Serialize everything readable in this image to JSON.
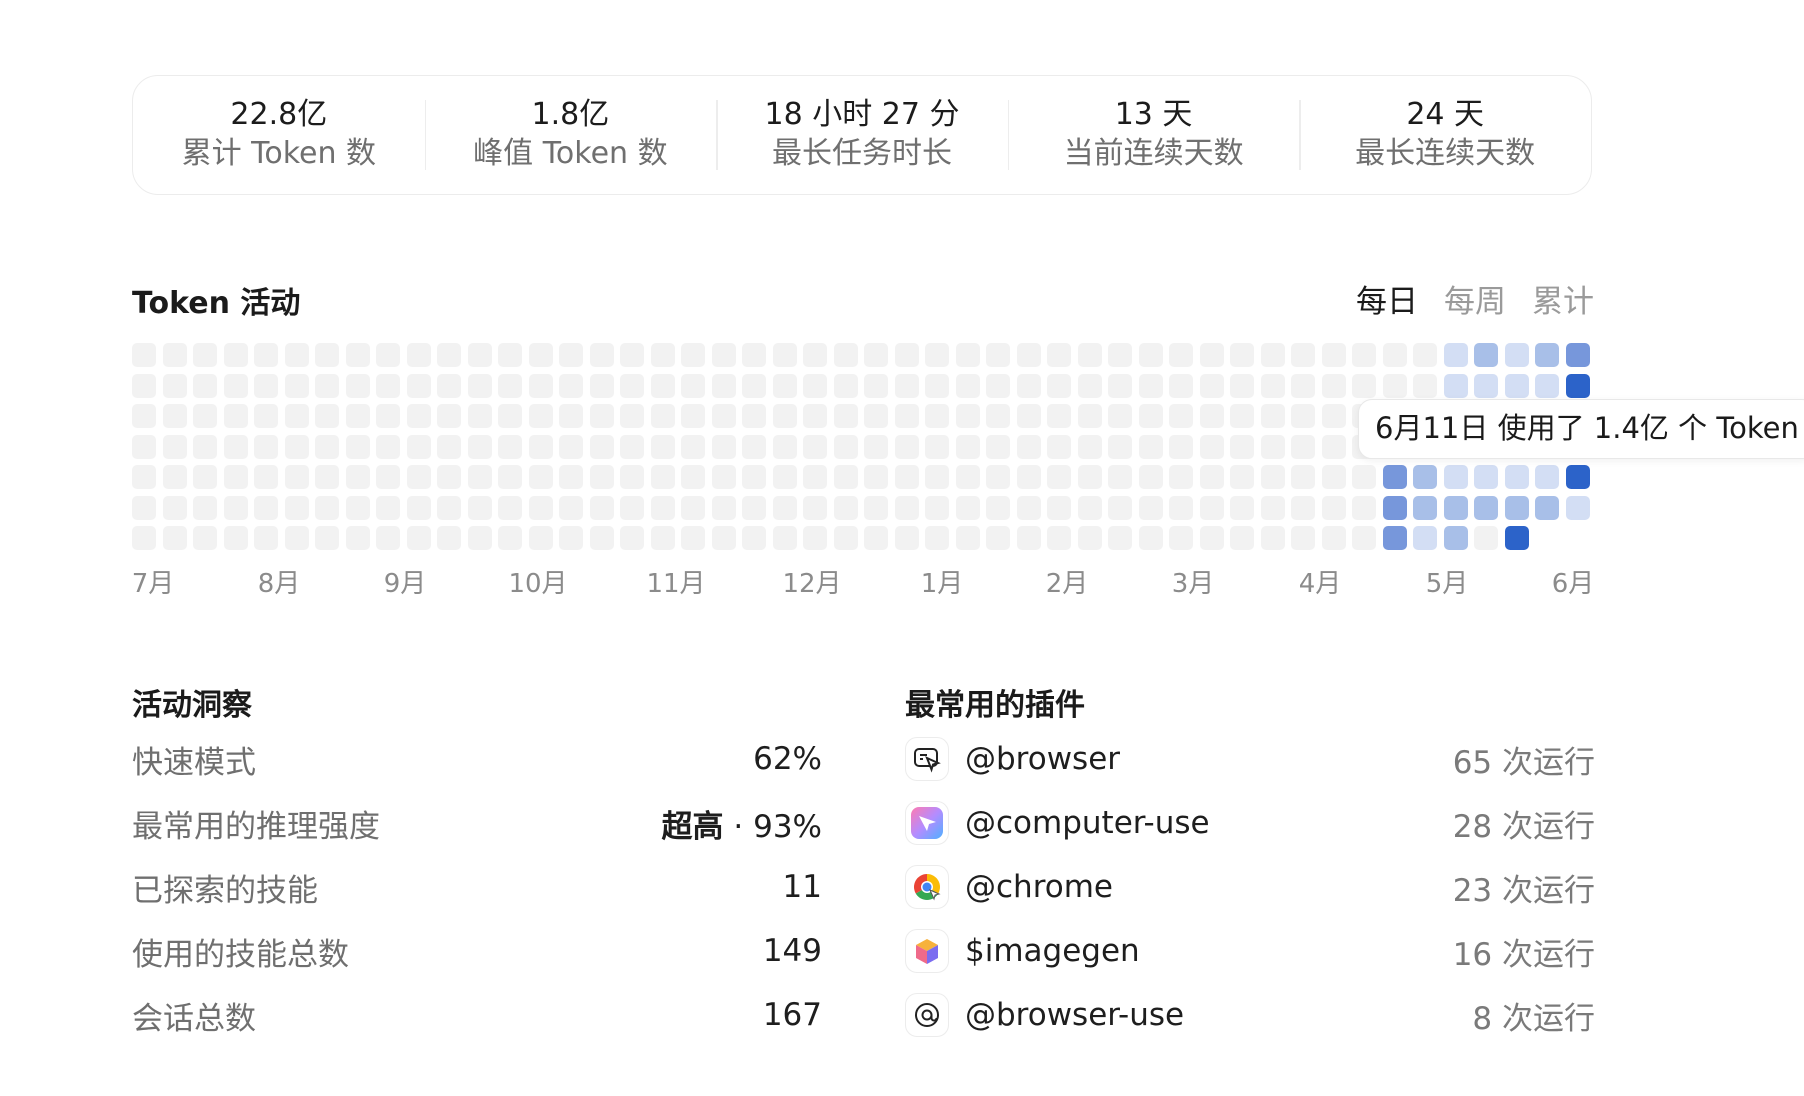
{
  "stats": [
    {
      "value": "22.8亿",
      "label": "累计 Token 数"
    },
    {
      "value": "1.8亿",
      "label": "峰值 Token 数"
    },
    {
      "value": "18 小时 27 分",
      "label": "最长任务时长"
    },
    {
      "value": "13 天",
      "label": "当前连续天数"
    },
    {
      "value": "24 天",
      "label": "最长连续天数"
    }
  ],
  "activity": {
    "title": "Token 活动",
    "tabs": [
      {
        "label": "每日",
        "active": true
      },
      {
        "label": "每周",
        "active": false
      },
      {
        "label": "累计",
        "active": false
      }
    ],
    "months": [
      "7月",
      "8月",
      "9月",
      "10月",
      "11月",
      "12月",
      "1月",
      "2月",
      "3月",
      "4月",
      "5月",
      "6月"
    ],
    "tooltip": "6月11日 使用了 1.4亿 个 Token",
    "level_colors": [
      "#f2f2f2",
      "#d3def4",
      "#a8bfe8",
      "#7797db",
      "#2c63c9"
    ],
    "week_count": 48,
    "active_weeks": [
      [
        0,
        0,
        0,
        0,
        0,
        0,
        0
      ],
      [
        0,
        0,
        0,
        0,
        0,
        0,
        0
      ],
      [
        0,
        0,
        0,
        0,
        3,
        3,
        3
      ],
      [
        0,
        0,
        0,
        0,
        2,
        2,
        1
      ],
      [
        1,
        1,
        0,
        0,
        1,
        2,
        2
      ],
      [
        2,
        1,
        0,
        0,
        1,
        2,
        0
      ],
      [
        1,
        1,
        0,
        0,
        1,
        2,
        4
      ],
      [
        2,
        1,
        0,
        0,
        1,
        2,
        -1
      ],
      [
        3,
        4,
        0,
        0,
        4,
        1,
        -1
      ]
    ]
  },
  "insights": {
    "title": "活动洞察",
    "rows": [
      {
        "label": "快速模式",
        "value": "62%"
      },
      {
        "label": "最常用的推理强度",
        "value_strong": "超高",
        "value": " · 93%"
      },
      {
        "label": "已探索的技能",
        "value": "11"
      },
      {
        "label": "使用的技能总数",
        "value": "149"
      },
      {
        "label": "会话总数",
        "value": "167"
      }
    ]
  },
  "plugins": {
    "title": "最常用的插件",
    "rows": [
      {
        "icon": "browser-cursor-icon",
        "name": "@browser",
        "count": "65 次运行"
      },
      {
        "icon": "computer-use-icon",
        "name": "@computer-use",
        "count": "28 次运行"
      },
      {
        "icon": "chrome-icon",
        "name": "@chrome",
        "count": "23 次运行"
      },
      {
        "icon": "imagegen-cube-icon",
        "name": "$imagegen",
        "count": "16 次运行"
      },
      {
        "icon": "browser-use-icon",
        "name": "@browser-use",
        "count": "8 次运行"
      }
    ]
  }
}
